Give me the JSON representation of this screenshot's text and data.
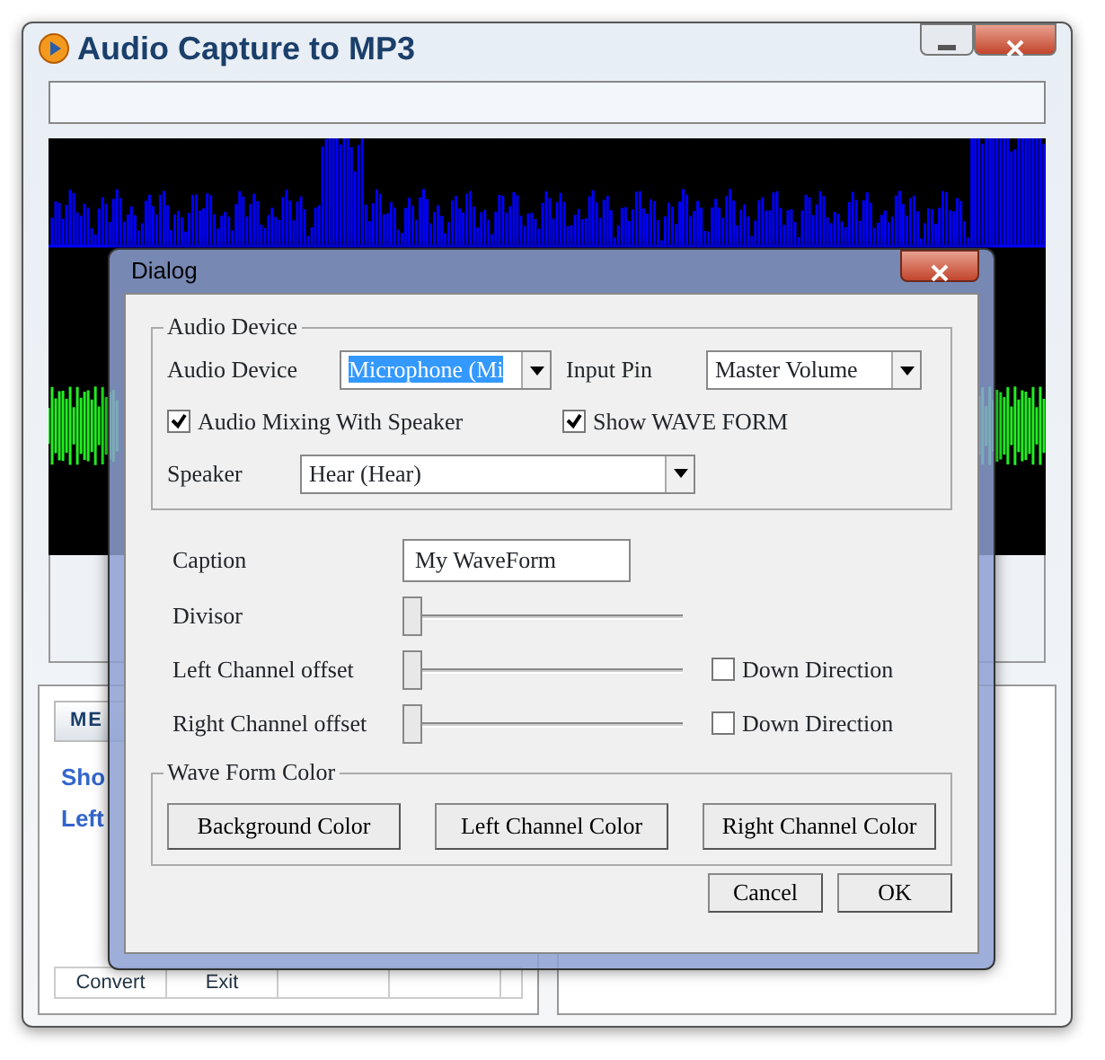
{
  "window": {
    "title": "Audio Capture to MP3"
  },
  "side_panel": {
    "header": "ME",
    "items": [
      "Sho",
      "Left"
    ],
    "toolbar": [
      "Convert",
      "Exit"
    ]
  },
  "dialog": {
    "title": "Dialog",
    "audio_device_group": {
      "legend": "Audio Device",
      "audio_device": {
        "label": "Audio Device",
        "value": "Microphone (Mi",
        "highlighted": true
      },
      "input_pin": {
        "label": "Input Pin",
        "value": "Master Volume"
      },
      "checkboxes": [
        {
          "label": "Audio Mixing With Speaker",
          "checked": true
        },
        {
          "label": "Show WAVE FORM",
          "checked": true
        }
      ],
      "speaker": {
        "label": "Speaker",
        "value": "Hear (Hear)"
      }
    },
    "caption": {
      "label": "Caption",
      "value": "My WaveForm"
    },
    "sliders": [
      {
        "label": "Divisor",
        "level": 0
      },
      {
        "label": "Left Channel offset",
        "level": 0,
        "checkbox": {
          "label": "Down Direction",
          "checked": false
        }
      },
      {
        "label": "Right Channel offset",
        "level": 0,
        "checkbox": {
          "label": "Down Direction",
          "checked": false
        }
      }
    ],
    "color_group": {
      "legend": "Wave Form Color",
      "buttons": [
        "Background Color",
        "Left Channel Color",
        "Right Channel Color"
      ]
    },
    "buttons": [
      "Cancel",
      "OK"
    ]
  }
}
